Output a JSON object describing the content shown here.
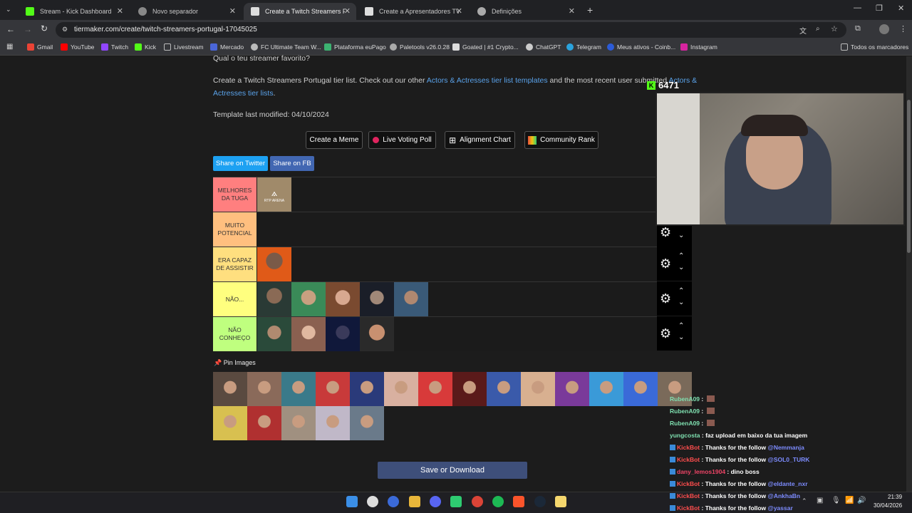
{
  "browser": {
    "tabs": [
      {
        "title": "Stream - Kick Dashboard"
      },
      {
        "title": "Novo separador"
      },
      {
        "title": "Create a Twitch Streamers Portu"
      },
      {
        "title": "Create a Apresentadores TV Po"
      },
      {
        "title": "Definições"
      }
    ],
    "url": "tiermaker.com/create/twitch-streamers-portugal-17045025",
    "bookmarks": [
      "Gmail",
      "YouTube",
      "Twitch",
      "Kick",
      "Livestream",
      "Mercado",
      "FC Ultimate Team W...",
      "Plataforma euPago",
      "Paletools v26.0.28",
      "Goated | #1 Crypto...",
      "ChatGPT",
      "Telegram",
      "Meus ativos - Coinb...",
      "Instagram"
    ],
    "all_bookmarks": "Todos os marcadores"
  },
  "page": {
    "question": "Qual o teu streamer favorito?",
    "desc_pre": "Create a Twitch Streamers Portugal tier list. Check out our other ",
    "desc_link1": "Actors & Actresses tier list templates",
    "desc_mid": " and the most recent user submitted ",
    "desc_link2": "Actors &",
    "desc_link3": "Actresses tier lists",
    "desc_end": ".",
    "modified": "Template last modified: 04/10/2024",
    "buttons": {
      "meme": "Create a Meme",
      "poll": "Live Voting Poll",
      "alignment": "Alignment Chart",
      "community": "Community Rank"
    },
    "share_twitter": "Share on Twitter",
    "share_fb": "Share on FB",
    "tiers": [
      {
        "label": "MELHORES DA TUGA",
        "color": "#ff7f7f"
      },
      {
        "label": "MUITO POTENCIAL",
        "color": "#ffbf7f"
      },
      {
        "label": "ERA CAPAZ DE ASSISTIR",
        "color": "#ffdf7f"
      },
      {
        "label": "NÃO...",
        "color": "#ffff7f"
      },
      {
        "label": "NÃO CONHEÇO",
        "color": "#bfff7f"
      }
    ],
    "rtp_logo_text": "RTP ARENA",
    "pin_images": "Pin Images",
    "save": "Save or Download"
  },
  "stream": {
    "viewers": "6471"
  },
  "chat": [
    {
      "user": "RubenA09",
      "msg": ""
    },
    {
      "user": "RubenA09",
      "msg": ""
    },
    {
      "user": "RubenA09",
      "msg": ""
    },
    {
      "user": "yungcosta",
      "msg": "faz upload em baixo da tua imagem"
    },
    {
      "user": "KickBot",
      "msg": "Thanks for the follow ",
      "mention": "@Nemmanja"
    },
    {
      "user": "KickBot",
      "msg": "Thanks for the follow ",
      "mention": "@SOL0_TURK"
    },
    {
      "user": "dany_lemos1904",
      "msg": "dino boss"
    },
    {
      "user": "KickBot",
      "msg": "Thanks for the follow ",
      "mention": "@eldante_nxr"
    },
    {
      "user": "KickBot",
      "msg": "Thanks for the follow ",
      "mention": "@AnkhaBn"
    },
    {
      "user": "KickBot",
      "msg": "Thanks for the follow ",
      "mention": "@yassar"
    }
  ],
  "system": {
    "time": "21:39",
    "date": "30/04/2026"
  }
}
